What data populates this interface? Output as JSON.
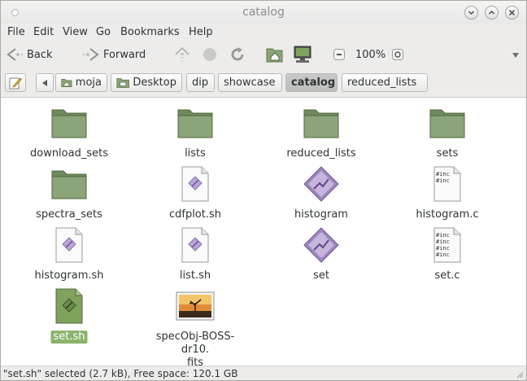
{
  "window": {
    "title": "catalog"
  },
  "menubar": {
    "items": [
      "File",
      "Edit",
      "View",
      "Go",
      "Bookmarks",
      "Help"
    ]
  },
  "toolbar": {
    "back_label": "Back",
    "forward_label": "Forward",
    "zoom_level": "100%"
  },
  "pathbar": {
    "crumbs": [
      "moja",
      "Desktop",
      "dip",
      "showcase",
      "catalog",
      "reduced_lists"
    ],
    "active": "catalog"
  },
  "files": [
    {
      "name": "download_sets",
      "icon": "folder-icon"
    },
    {
      "name": "lists",
      "icon": "folder-icon"
    },
    {
      "name": "reduced_lists",
      "icon": "folder-icon"
    },
    {
      "name": "sets",
      "icon": "folder-icon"
    },
    {
      "name": "spectra_sets",
      "icon": "folder-icon"
    },
    {
      "name": "cdfplot.sh",
      "icon": "script-file-icon"
    },
    {
      "name": "histogram",
      "icon": "executable-icon"
    },
    {
      "name": "histogram.c",
      "icon": "c-source-file-icon"
    },
    {
      "name": "histogram.sh",
      "icon": "script-file-icon"
    },
    {
      "name": "list.sh",
      "icon": "script-file-icon"
    },
    {
      "name": "set",
      "icon": "executable-icon"
    },
    {
      "name": "set.c",
      "icon": "c-source-file-icon"
    },
    {
      "name": "set.sh",
      "icon": "script-file-icon",
      "selected": true
    },
    {
      "name": "specObj-BOSS-dr10.fits",
      "name_line1": "specObj-BOSS-dr10.",
      "name_line2": "fits",
      "icon": "image-file-icon"
    }
  ],
  "statusbar": {
    "text": "\"set.sh\" selected (2.7 kB), Free space: 120.1 GB"
  },
  "colors": {
    "folder": "#8ba478",
    "selection": "#8ab46c",
    "executable": "#9f86c0"
  }
}
